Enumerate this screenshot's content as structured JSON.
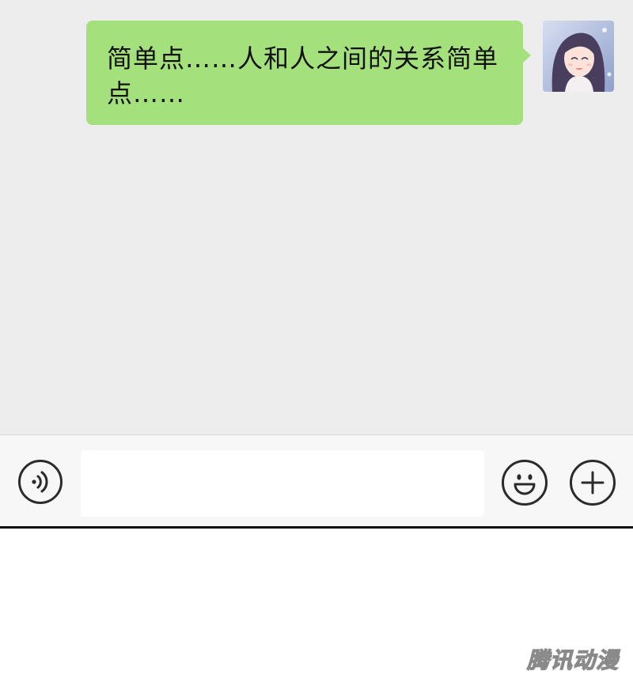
{
  "conversation": {
    "messages": [
      {
        "sender": "me",
        "text": "简单点……人和人之间的关系简单点……"
      }
    ]
  },
  "input_bar": {
    "voice_icon": "voice-icon",
    "text_value": "",
    "emoji_icon": "smiley-face-icon",
    "plus_icon": "plus-icon"
  },
  "colors": {
    "chat_background": "#ededed",
    "outgoing_bubble": "#a4e17c",
    "input_bar_background": "#f7f7f7",
    "page_background": "#ffffff"
  },
  "watermark": {
    "text": "腾讯动漫"
  }
}
